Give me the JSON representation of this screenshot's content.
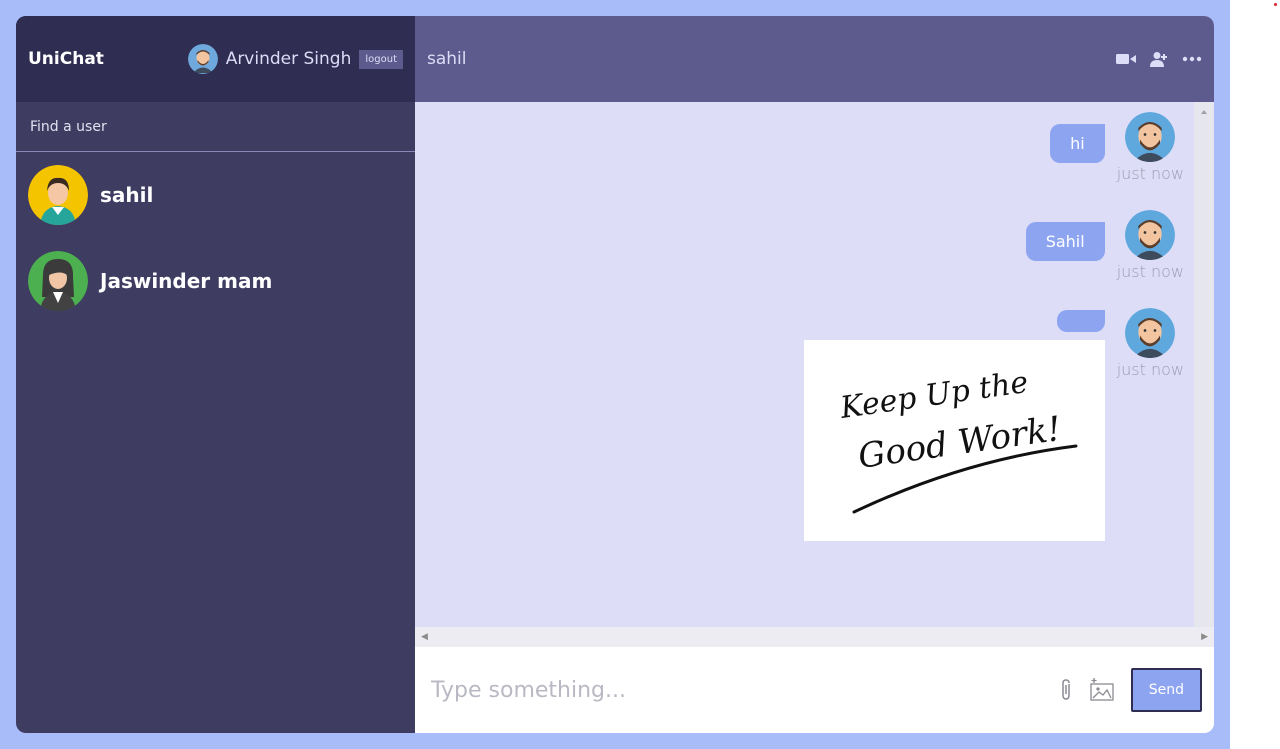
{
  "sidebar": {
    "logo": "UniChat",
    "current_user": "Arvinder Singh",
    "logout_label": "logout",
    "search_placeholder": "Find a user",
    "chats": [
      {
        "name": "sahil",
        "avatar": "male-avatar-yellow"
      },
      {
        "name": "Jaswinder mam",
        "avatar": "female-avatar-green"
      }
    ]
  },
  "chat": {
    "title": "sahil",
    "icons": [
      "video-icon",
      "add-user-icon",
      "more-icon"
    ],
    "messages": [
      {
        "text": "hi",
        "time": "just now"
      },
      {
        "text": "Sahil",
        "time": "just now"
      },
      {
        "text": "",
        "time": "just now",
        "image_text": [
          "Keep Up the",
          "Good Work!"
        ]
      }
    ],
    "input_placeholder": "Type something...",
    "send_label": "Send"
  },
  "colors": {
    "background": "#a7bcf9",
    "sidebar": "#3e3c61",
    "sidebar_nav": "#2f2d52",
    "chat_header": "#5d5b8d",
    "chat_bg": "#ddddf7",
    "bubble": "#8da4f1"
  }
}
